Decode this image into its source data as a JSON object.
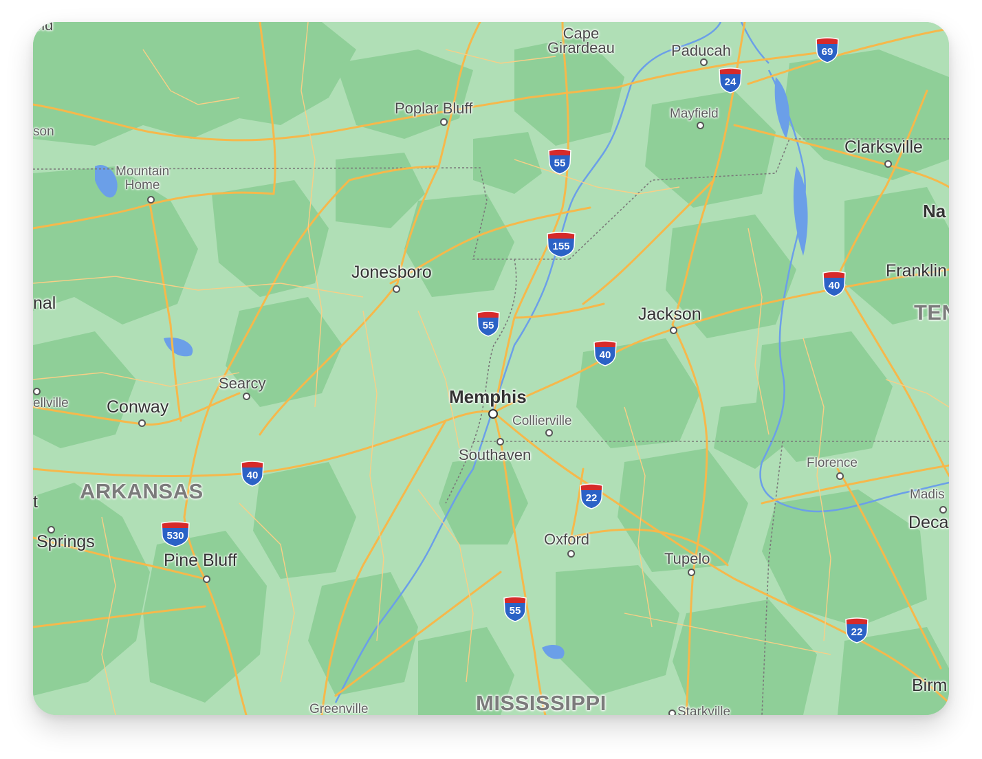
{
  "map": {
    "colors": {
      "land": "#b0dfb6",
      "forest": "#8fcf98",
      "road": "#f6b84b",
      "water": "#6b9fe8",
      "border": "#7a7a7a",
      "shield_blue": "#2b62c6",
      "shield_red": "#d62a2a"
    },
    "cities": {
      "cape_girardeau": "Cape\nGirardeau",
      "paducah": "Paducah",
      "poplar_bluff": "Poplar Bluff",
      "mayfield": "Mayfield",
      "clarksville": "Clarksville",
      "mountain_home": "Mountain\nHome",
      "jonesboro": "Jonesboro",
      "jackson": "Jackson",
      "franklin": "Franklin",
      "memphis": "Memphis",
      "collierville": "Collierville",
      "southaven": "Southaven",
      "searcy": "Searcy",
      "conway": "Conway",
      "bellville": "ellville",
      "pine_bluff": "Pine Bluff",
      "springs": "Springs",
      "oxford": "Oxford",
      "tupelo": "Tupelo",
      "florence": "Florence",
      "madison": "Madis",
      "decatur": "Deca",
      "greenville": "Greenville",
      "starkville": "Starkville",
      "birmingham": "Birm",
      "nashville": "Na",
      "gold": "old",
      "eson": "son",
      "nal": "nal",
      "t": "t"
    },
    "states": {
      "arkansas": "ARKANSAS",
      "mississippi": "MISSISSIPPI",
      "tennessee": "TEN"
    },
    "shields": [
      "69",
      "24",
      "55",
      "155",
      "40",
      "55",
      "40",
      "40",
      "22",
      "530",
      "55",
      "22"
    ]
  }
}
